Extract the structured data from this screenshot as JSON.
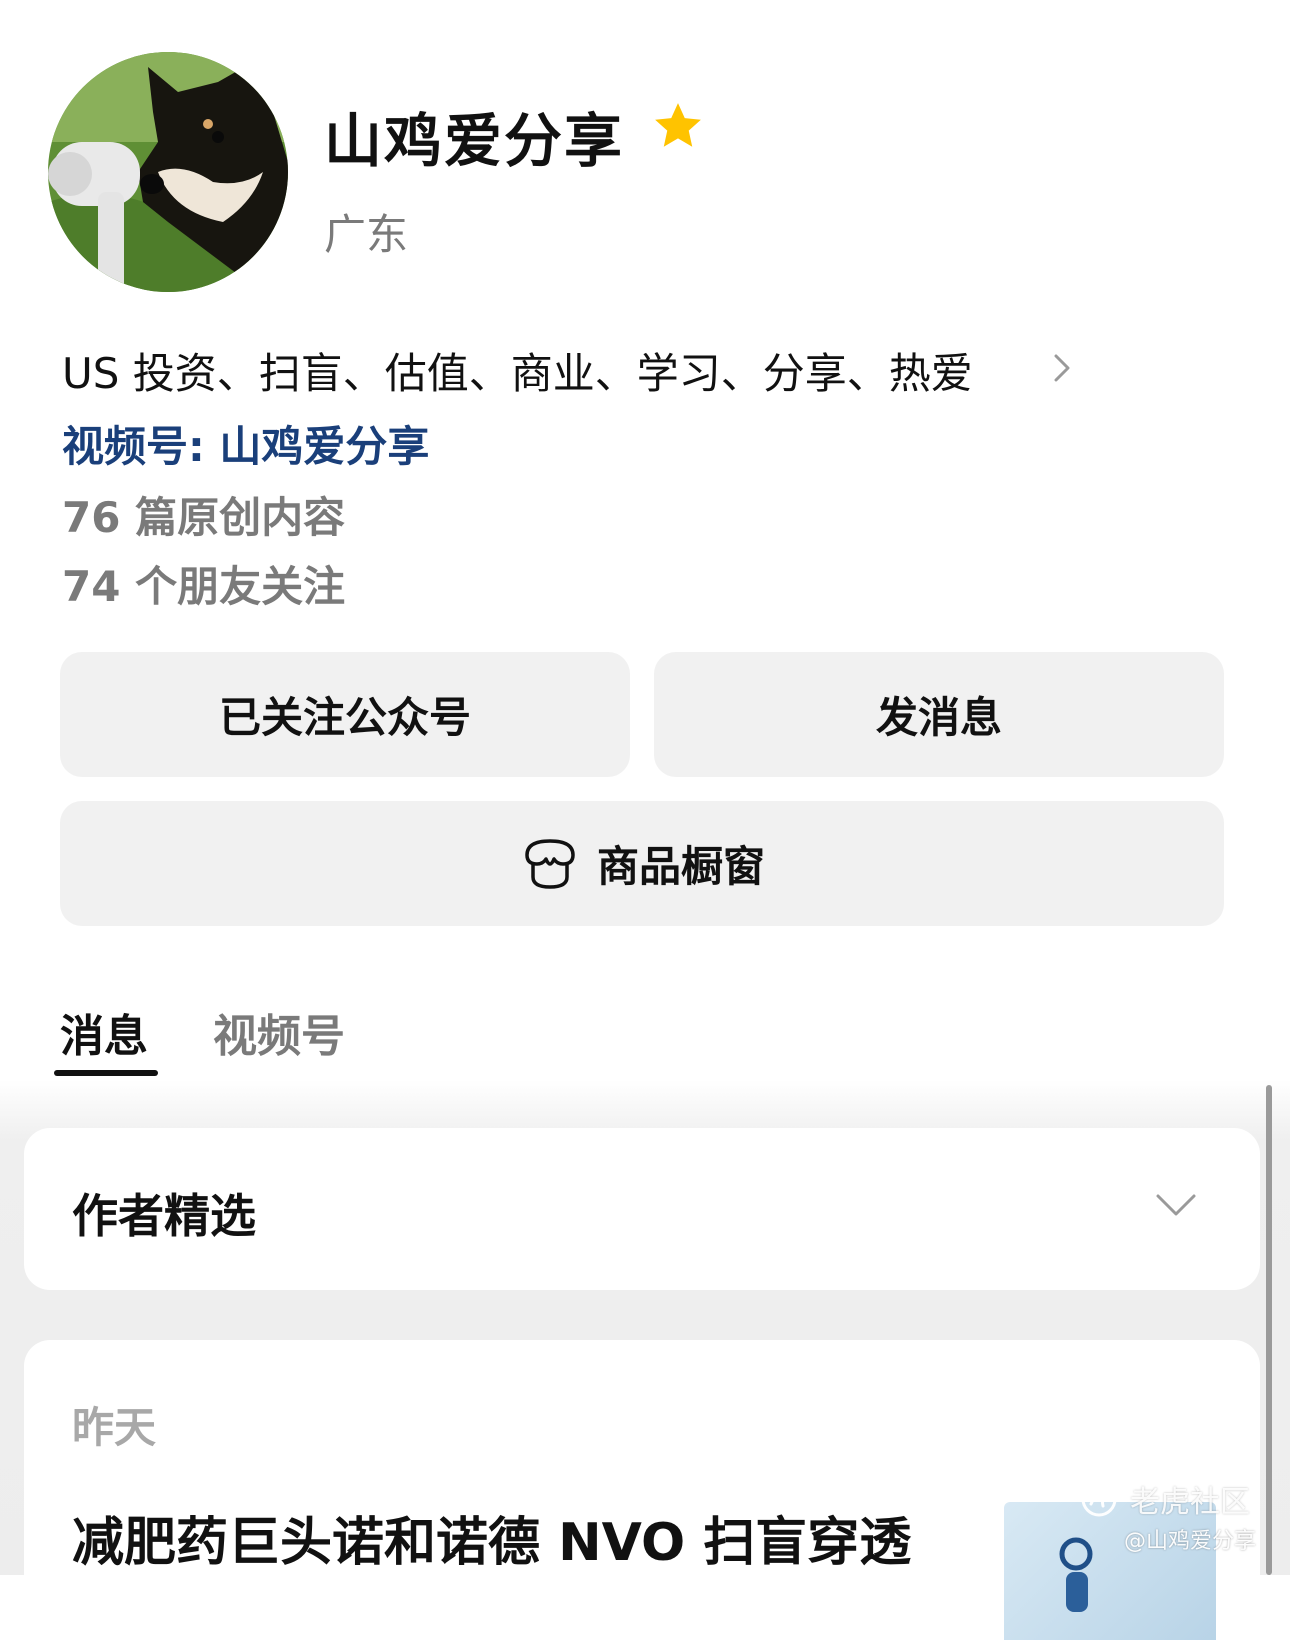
{
  "profile": {
    "name": "山鸡爱分享",
    "region": "广东",
    "bio": "US 投资、扫盲、估值、商业、学习、分享、热爱",
    "channel_link": "视频号: 山鸡爱分享",
    "original_count": "76 篇原创内容",
    "friends_following": "74 个朋友关注",
    "star_color": "#FFC300"
  },
  "actions": {
    "follow_label": "已关注公众号",
    "message_label": "发消息",
    "shop_label": "商品橱窗"
  },
  "tabs": [
    {
      "label": "消息",
      "active": true
    },
    {
      "label": "视频号",
      "active": false
    }
  ],
  "picks": {
    "title": "作者精选"
  },
  "feed": {
    "date": "昨天",
    "post_title": "减肥药巨头诺和诺德 NVO 扫盲穿透"
  },
  "watermark": {
    "brand": "老虎社区",
    "handle": "@山鸡爱分享"
  }
}
